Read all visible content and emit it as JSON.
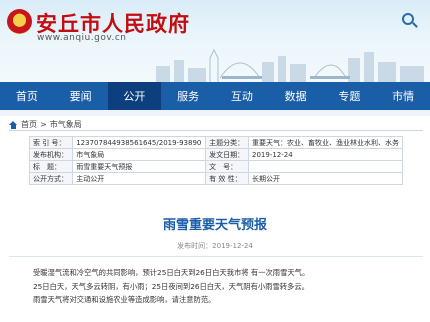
{
  "header": {
    "site_title": "安丘市人民政府",
    "site_url": "www.anqiu.gov.cn"
  },
  "nav": {
    "items": [
      {
        "label": "首页"
      },
      {
        "label": "要闻"
      },
      {
        "label": "公开"
      },
      {
        "label": "服务"
      },
      {
        "label": "互动"
      },
      {
        "label": "数据"
      },
      {
        "label": "专题"
      },
      {
        "label": "市情"
      }
    ]
  },
  "breadcrumb": {
    "home": "首页",
    "separator": ">",
    "current": "市气象局"
  },
  "info_table": {
    "index_label": "索 引 号：",
    "index_value": "123707844938561645/2019-93890",
    "category_label": "主题分类：",
    "category_value": "重要天气：农业、畜牧业、渔业林业水利、水务",
    "publisher_label": "发布机构：",
    "publisher_value": "市气象局",
    "date_label": "发文日期：",
    "date_value": "2019-12-24",
    "title_label": "标　题：",
    "title_value": "雨雪重要天气预报",
    "docno_label": "文　号：",
    "docno_value": "",
    "scope_label": "公开方式：",
    "scope_value": "主动公开",
    "validity_label": "有 效 性：",
    "validity_value": "长期公开"
  },
  "article": {
    "title": "雨雪重要天气预报",
    "date": "发布时间：2019-12-24",
    "paragraphs": [
      "受暖湿气流和冷空气的共同影响，预计25日白天到26日白天我市将 有一次雨雪天气。",
      "25日白天，天气多云转阴，有小雨；25日夜间到26日白天，天气阴有小雨雪转多云。",
      "雨雪天气将对交通和设施农业等造成影响，请注意防范。"
    ]
  },
  "colors": {
    "brand_red": "#c20e12",
    "nav_blue": "#1b5ea8",
    "nav_active": "#0d3f7e"
  }
}
